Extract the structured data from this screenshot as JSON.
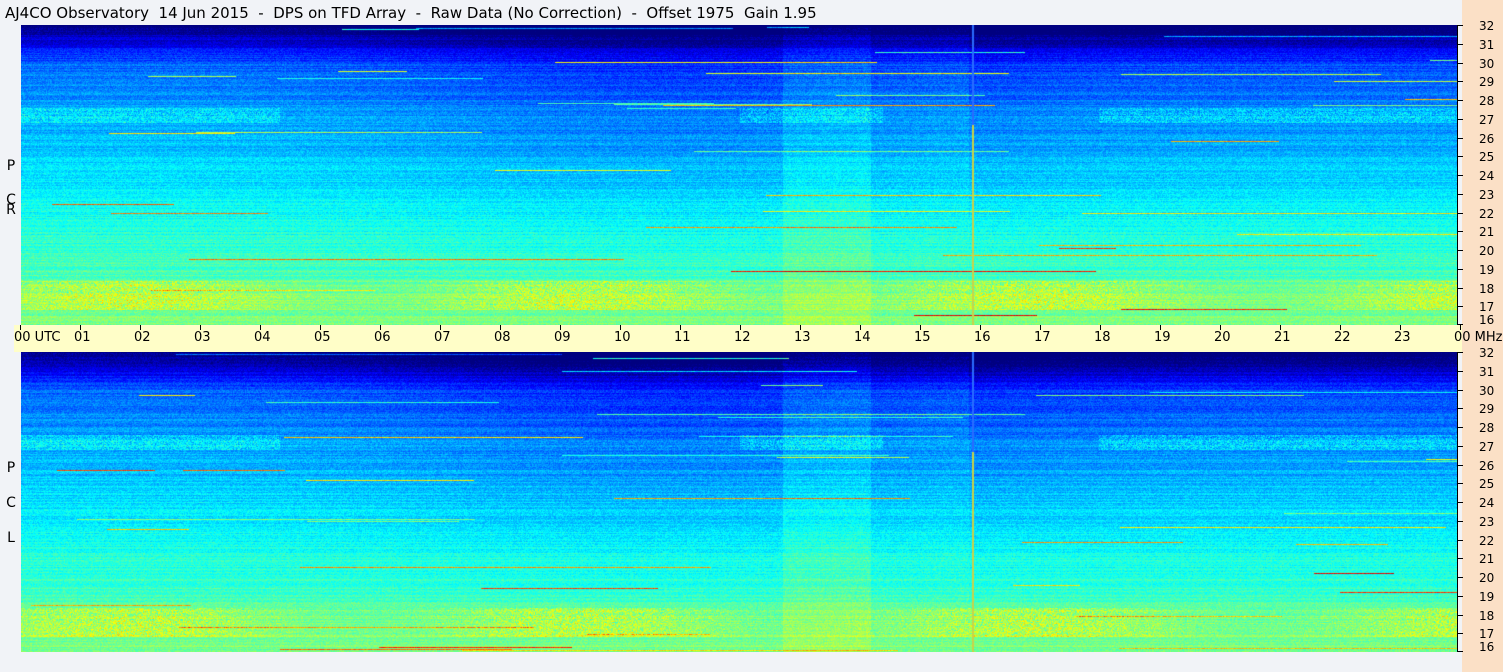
{
  "title": "AJ4CO Observatory  14 Jun 2015  -  DPS on TFD Array  -  Raw Data (No Correction)  -  Offset 1975  Gain 1.95",
  "panels": [
    {
      "id": "rcp",
      "label_letters": [
        "P",
        "C",
        "R"
      ]
    },
    {
      "id": "lcp",
      "label_letters": [
        "P",
        "C",
        "L"
      ]
    }
  ],
  "time_axis": {
    "labels": [
      "00  UTC",
      "01",
      "02",
      "03",
      "04",
      "05",
      "06",
      "07",
      "08",
      "09",
      "10",
      "11",
      "12",
      "13",
      "14",
      "15",
      "16",
      "17",
      "18",
      "19",
      "20",
      "21",
      "22",
      "23",
      "00 MHz"
    ]
  },
  "frequency_axis": {
    "labels": [
      "32",
      "31",
      "30",
      "29",
      "28",
      "27",
      "26",
      "25",
      "24",
      "23",
      "22",
      "21",
      "20",
      "19",
      "18",
      "17",
      "16"
    ]
  },
  "colors": {
    "background": "#f1f3f7",
    "time_bar": "#fffec8",
    "right_strip": "#fbe0c6",
    "marker_blue": "#2a6cff",
    "marker_yellow": "#c8d24a"
  }
}
